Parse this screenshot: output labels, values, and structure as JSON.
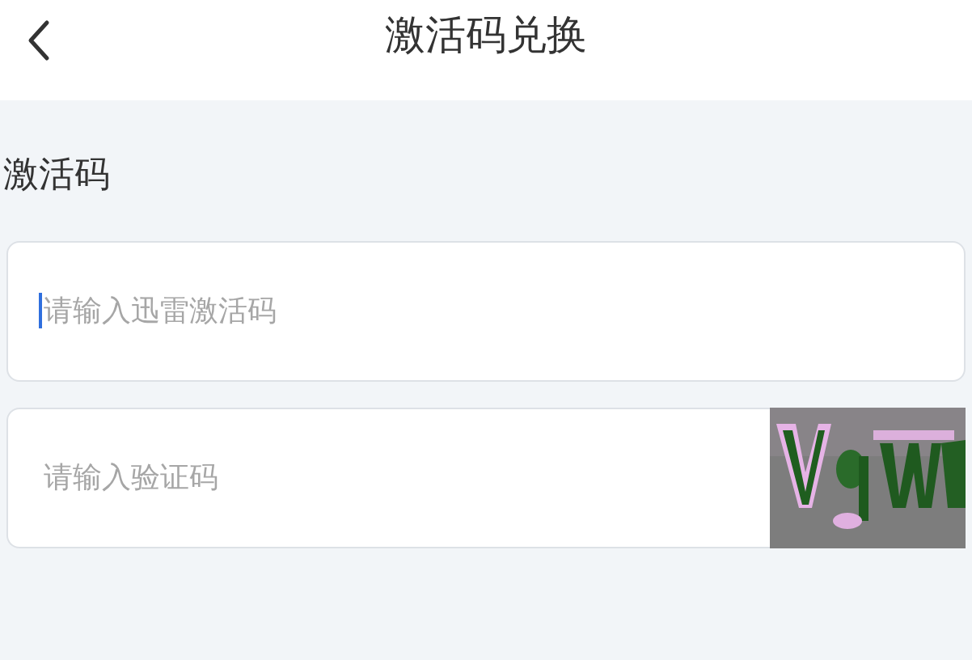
{
  "header": {
    "title": "激活码兑换"
  },
  "section_label": "激活码",
  "fields": [
    {
      "kind": "text",
      "placeholder": "请输入迅雷激活码",
      "focused": true
    },
    {
      "kind": "captcha",
      "placeholder": "请输入验证码",
      "focused": false
    }
  ]
}
